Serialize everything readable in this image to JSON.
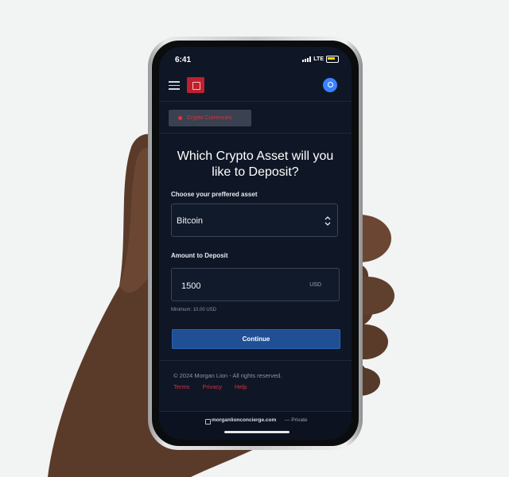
{
  "status": {
    "time": "6:41",
    "network": "LTE"
  },
  "header": {
    "menu_icon": "hamburger-icon",
    "logo_icon": "bank-logo-icon",
    "avatar_icon": "user-icon",
    "brand_color": "#c0202e",
    "avatar_color": "#3a82ff"
  },
  "tabs": {
    "active_label": "Crypto Currencies"
  },
  "main": {
    "title": "Which Crypto Asset will you like to Deposit?",
    "asset_label": "Choose your preffered asset",
    "asset_value": "Bitcoin",
    "amount_label": "Amount to Deposit",
    "amount_value": "1500",
    "currency": "USD",
    "minimum_note": "Minimum: 10.00 USD",
    "continue_label": "Continue",
    "continue_color": "#1f4f95"
  },
  "footer": {
    "copyright": "© 2024 Morgan Lion - All rights reserved.",
    "links": [
      "Terms",
      "Privacy",
      "Help"
    ],
    "link_color": "#d5303d"
  },
  "browser": {
    "url": "morganlionconcierge.com",
    "privacy": "— Private"
  }
}
